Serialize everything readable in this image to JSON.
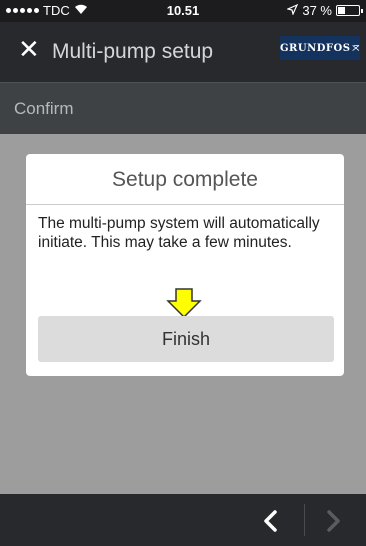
{
  "status_bar": {
    "carrier": "TDC",
    "time": "10.51",
    "battery_text": "37 %",
    "battery_level": 0.37,
    "icons": [
      "signal-dots-icon",
      "wifi-icon",
      "location-icon",
      "battery-icon"
    ]
  },
  "header": {
    "title": "Multi-pump setup",
    "close_icon": "close-icon",
    "logo_text": "GRUNDFOS"
  },
  "subheader": {
    "title": "Confirm"
  },
  "dialog": {
    "title": "Setup complete",
    "message": "The multi-pump system will automatically initiate. This may take a few minutes.",
    "button_label": "Finish",
    "hint_icon": "arrow-down-icon"
  },
  "footer": {
    "icons": [
      "chevron-left-icon",
      "chevron-right-icon"
    ]
  },
  "colors": {
    "header_bg": "#27292c",
    "subheader_bg": "#3f4245",
    "overlay_bg": "#9d9d9d",
    "logo_bg": "#13325e",
    "arrow_fill": "#ffff00"
  }
}
